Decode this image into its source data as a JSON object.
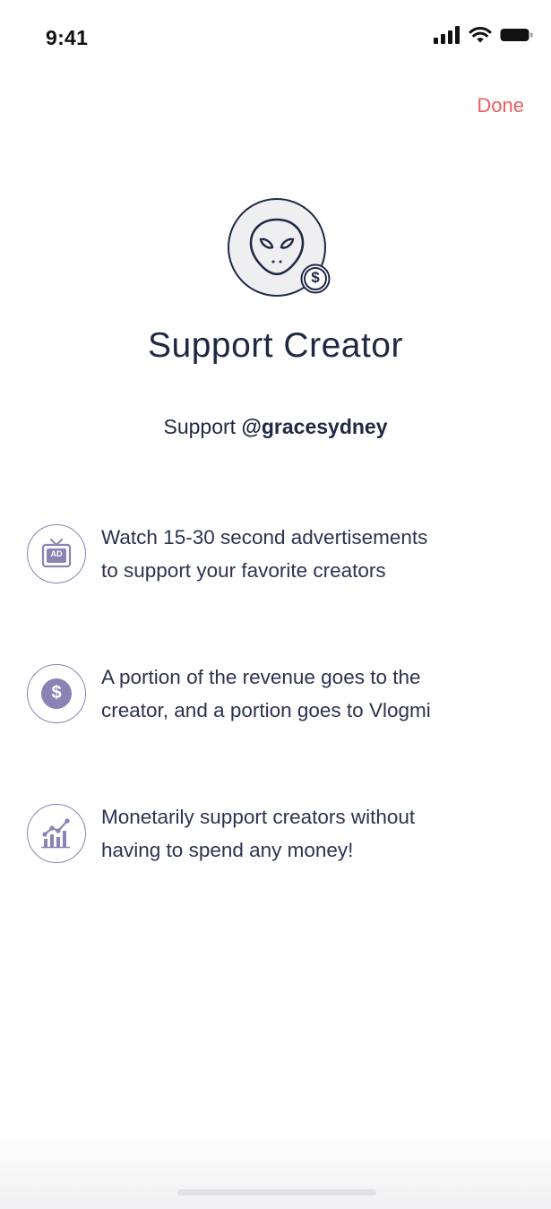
{
  "status_bar": {
    "time": "9:41",
    "icons": [
      "cellular-signal-icon",
      "wifi-icon",
      "battery-icon"
    ]
  },
  "header": {
    "done_label": "Done"
  },
  "colors": {
    "accent": "#ec5c5c",
    "text_primary": "#1f2944",
    "icon_purple": "#8a83b4"
  },
  "avatar": {
    "icon": "alien-icon",
    "badge_icon": "dollar-badge-icon",
    "badge_symbol": "$"
  },
  "title": "Support Creator",
  "support": {
    "prefix": "Support",
    "handle": "@gracesydney"
  },
  "features": [
    {
      "icon": "tv-ad-icon",
      "icon_label": "AD",
      "line1": "Watch 15-30 second advertisements",
      "line2": "to support your favorite creators"
    },
    {
      "icon": "dollar-coin-icon",
      "icon_label": "$",
      "line1": "A portion of the revenue goes to the",
      "line2": "creator, and a portion goes to Vlogmi"
    },
    {
      "icon": "growth-chart-icon",
      "line1": "Monetarily support creators without",
      "line2": "having to spend any money!"
    }
  ]
}
